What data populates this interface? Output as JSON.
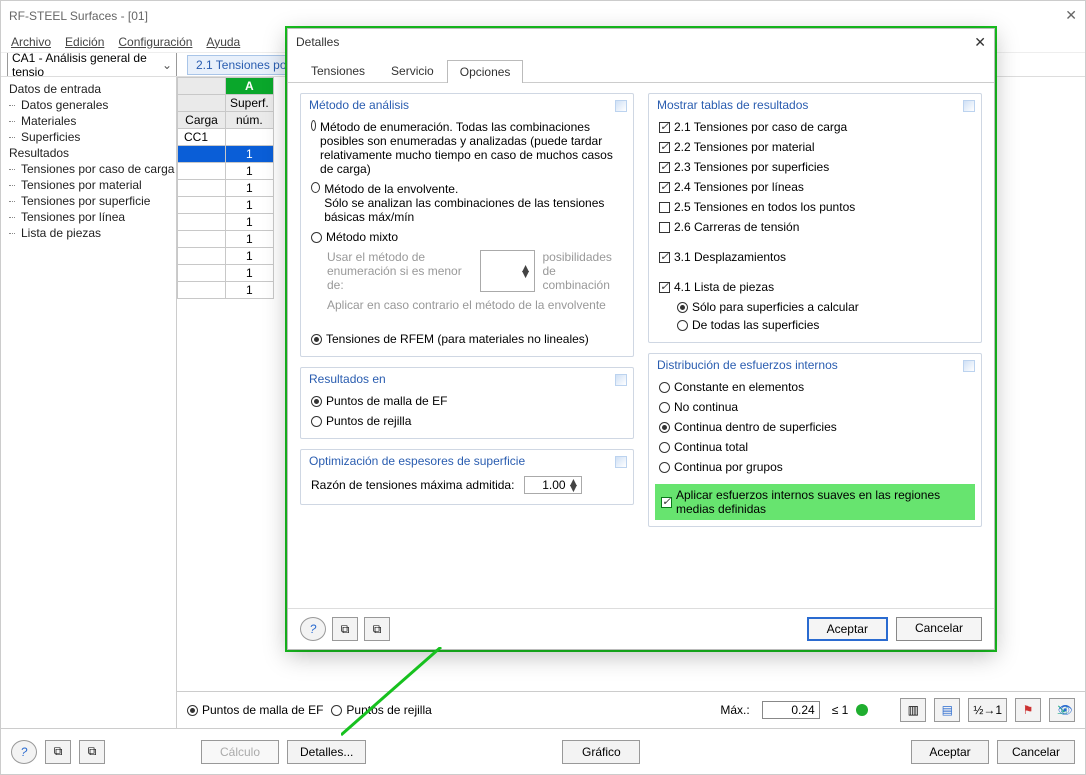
{
  "window": {
    "title": "RF-STEEL Surfaces - [01]"
  },
  "menu": {
    "file": "Archivo",
    "edit": "Edición",
    "config": "Configuración",
    "help": "Ayuda"
  },
  "combo": {
    "text": "CA1 - Análisis general de tensio"
  },
  "sheet_tab": "2.1 Tensiones por c",
  "tree": {
    "entry": "Datos de entrada",
    "entry_items": [
      "Datos generales",
      "Materiales",
      "Superficies"
    ],
    "results": "Resultados",
    "result_items": [
      "Tensiones por caso de carga",
      "Tensiones por material",
      "Tensiones por superficie",
      "Tensiones por línea",
      "Lista de piezas"
    ]
  },
  "grid": {
    "colA": "A",
    "hSurf": "Superf.",
    "hNum": "núm.",
    "hLoad": "Carga",
    "cc1": "CC1",
    "one": "1"
  },
  "lower": {
    "rFE": "Puntos de malla de EF",
    "rGrid": "Puntos de rejilla",
    "max": "Máx.:",
    "val": "0.24",
    "le": "≤ 1"
  },
  "bottom": {
    "calc": "Cálculo",
    "det": "Detalles...",
    "graf": "Gráfico",
    "ok": "Aceptar",
    "cancel": "Cancelar"
  },
  "dlg": {
    "title": "Detalles",
    "tabs": {
      "t1": "Tensiones",
      "t2": "Servicio",
      "t3": "Opciones"
    },
    "g1_title": "Método de análisis",
    "g1_r1": "Método de enumeración. Todas las combinaciones posibles son enumeradas y analizadas (puede tardar relativamente mucho tiempo en caso de muchos casos de carga)",
    "g1_r2": "Método de la envolvente.\nSólo se analizan las combinaciones de las tensiones básicas máx/mín",
    "g1_r3": "Método mixto",
    "g1_r3a": "Usar el método de\nenumeración si es menor de:",
    "g1_r3b": "posibilidades de\ncombinación",
    "g1_r3c": "Aplicar en caso contrario el método de la envolvente",
    "g1_r4": "Tensiones de RFEM (para materiales no lineales)",
    "g2_title": "Resultados en",
    "g2_r1": "Puntos de malla de EF",
    "g2_r2": "Puntos de rejilla",
    "g3_title": "Optimización de espesores de superficie",
    "g3_l": "Razón de tensiones máxima admitida:",
    "g3_v": "1.00",
    "g4_title": "Mostrar tablas de resultados",
    "g4": [
      "2.1 Tensiones por caso de carga",
      "2.2 Tensiones por material",
      "2.3 Tensiones por superficies",
      "2.4 Tensiones por líneas",
      "2.5 Tensiones en todos los puntos",
      "2.6 Carreras de tensión",
      "3.1 Desplazamientos",
      "4.1 Lista de piezas"
    ],
    "g4_s1": "Sólo para superficies a calcular",
    "g4_s2": "De todas las superficies",
    "g5_title": "Distribución de esfuerzos internos",
    "g5": [
      "Constante en elementos",
      "No continua",
      "Continua dentro de superficies",
      "Continua total",
      "Continua por grupos"
    ],
    "g5_hl": "Aplicar esfuerzos internos suaves en las regiones medias definidas",
    "ok": "Aceptar",
    "cancel": "Cancelar"
  }
}
